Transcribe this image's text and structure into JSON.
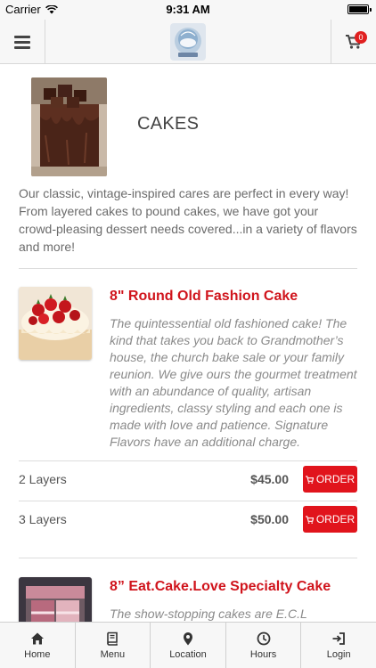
{
  "status": {
    "carrier": "Carrier",
    "time": "9:31 AM"
  },
  "navbar": {
    "cart_count": "0"
  },
  "category": {
    "title": "CAKES",
    "description": "Our classic, vintage-inspired cares are perfect in every way! From layered cakes to pound cakes, we have got your crowd-pleasing dessert needs covered...in a variety of flavors and more!"
  },
  "items": [
    {
      "title": "8\" Round Old Fashion Cake",
      "description": "The quintessential old fashioned cake! The kind that takes you back to Grandmother’s house, the church bake sale or your family reunion. We give ours the gourmet treatment with an abundance of quality, artisan ingredients, classy styling and each one is made with love and patience. Signature Flavors have an additional charge.",
      "options": [
        {
          "label": "2 Layers",
          "price": "$45.00",
          "button": "ORDER"
        },
        {
          "label": "3 Layers",
          "price": "$50.00",
          "button": "ORDER"
        }
      ]
    },
    {
      "title": "8” Eat.Cake.Love Specialty Cake",
      "description": "The show-stopping cakes are E.C.L Originals."
    }
  ],
  "tabs": [
    {
      "label": "Home",
      "icon": "home-icon"
    },
    {
      "label": "Menu",
      "icon": "book-icon"
    },
    {
      "label": "Location",
      "icon": "map-pin-icon"
    },
    {
      "label": "Hours",
      "icon": "clock-icon"
    },
    {
      "label": "Login",
      "icon": "login-icon"
    }
  ],
  "colors": {
    "accent": "#e1141c",
    "title_red": "#d0141c",
    "bar_bg": "#f7f7f7"
  }
}
